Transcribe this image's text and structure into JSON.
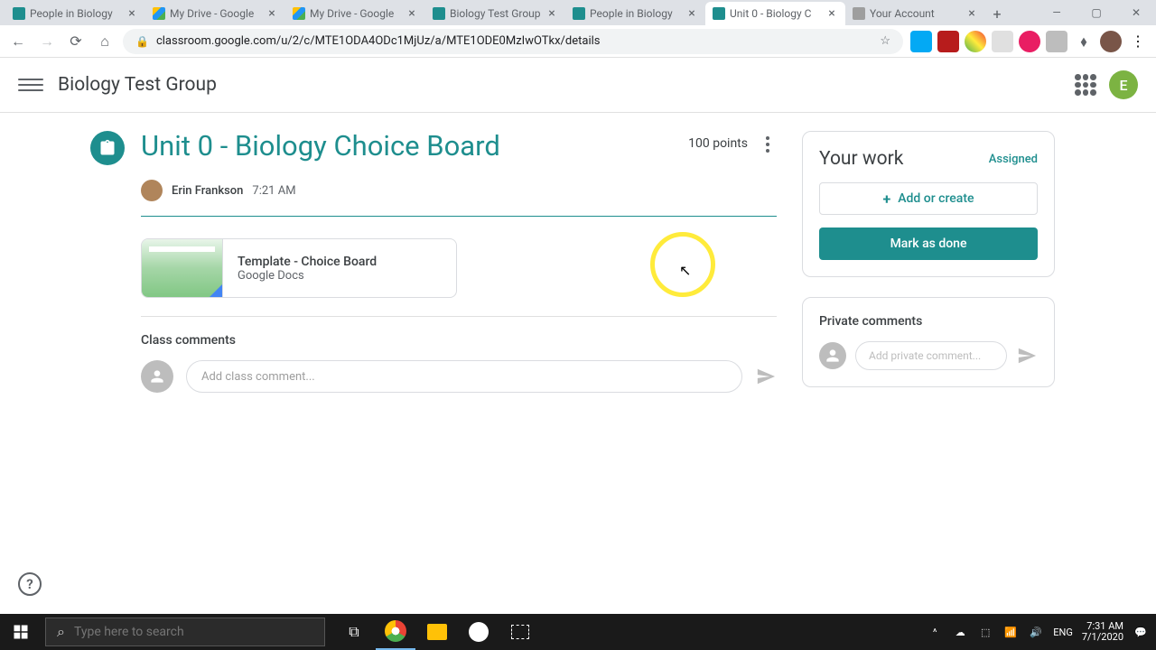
{
  "browser": {
    "tabs": [
      {
        "title": "People in Biology",
        "favicon": "classroom"
      },
      {
        "title": "My Drive - Google",
        "favicon": "drive"
      },
      {
        "title": "My Drive - Google",
        "favicon": "drive"
      },
      {
        "title": "Biology Test Group",
        "favicon": "classroom"
      },
      {
        "title": "People in Biology",
        "favicon": "classroom"
      },
      {
        "title": "Unit 0 - Biology C",
        "favicon": "classroom",
        "active": true
      },
      {
        "title": "Your Account",
        "favicon": "gray"
      }
    ],
    "url": "classroom.google.com/u/2/c/MTE1ODA4ODc1MjUz/a/MTE1ODE0MzIwOTkx/details"
  },
  "header": {
    "class_title": "Biology Test Group",
    "avatar_letter": "E"
  },
  "assignment": {
    "title": "Unit 0 - Biology Choice Board",
    "points": "100 points",
    "author": "Erin Frankson",
    "time": "7:21 AM",
    "attachment": {
      "title": "Template - Choice Board",
      "subtitle": "Google Docs"
    },
    "class_comments_label": "Class comments",
    "class_comment_placeholder": "Add class comment..."
  },
  "your_work": {
    "title": "Your work",
    "status": "Assigned",
    "add_label": "Add or create",
    "mark_done_label": "Mark as done"
  },
  "private_comments": {
    "title": "Private comments",
    "placeholder": "Add private comment..."
  },
  "taskbar": {
    "search_placeholder": "Type here to search",
    "lang": "ENG",
    "time": "7:31 AM",
    "date": "7/1/2020"
  }
}
